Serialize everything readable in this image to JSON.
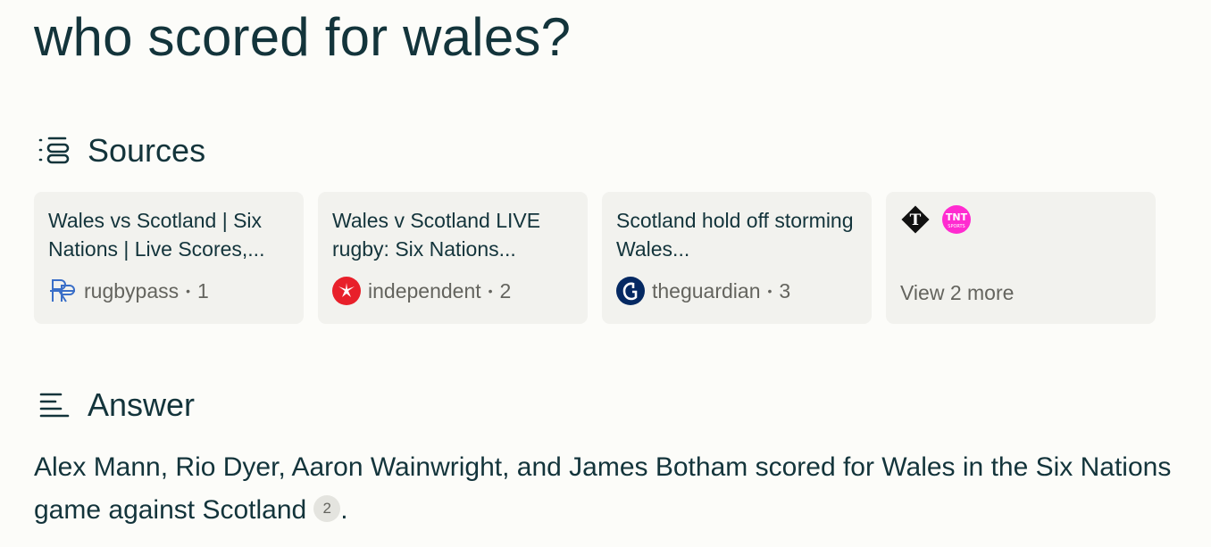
{
  "query": "who scored for wales?",
  "sources": {
    "header": "Sources",
    "cards": [
      {
        "title": "Wales vs Scotland | Six Nations | Live Scores,...",
        "site": "rugbypass",
        "num": "1",
        "icon": "rugbypass-icon"
      },
      {
        "title": "Wales v Scotland LIVE rugby: Six Nations...",
        "site": "independent",
        "num": "2",
        "icon": "independent-icon"
      },
      {
        "title": "Scotland hold off storming Wales...",
        "site": "theguardian",
        "num": "3",
        "icon": "theguardian-icon"
      }
    ],
    "more": {
      "label": "View 2 more",
      "icons": [
        "telegraph-icon",
        "tnt-sports-icon"
      ],
      "tnt_text": "TNT",
      "tnt_sub": "SPORTS"
    },
    "separator": "•"
  },
  "answer": {
    "header": "Answer",
    "text": "Alex Mann, Rio Dyer, Aaron Wainwright, and James Botham scored for Wales in the Six Nations game against Scotland",
    "citation": "2",
    "end": "."
  },
  "colors": {
    "background": "#fcfcf9",
    "text": "#13343b",
    "card": "#f2f2ee",
    "muted": "#64645e"
  }
}
